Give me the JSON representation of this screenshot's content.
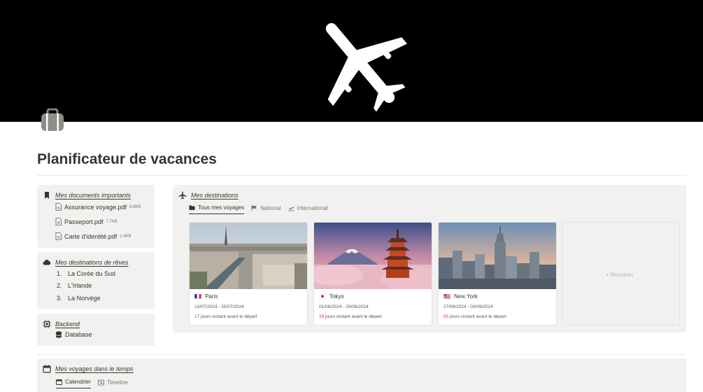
{
  "page": {
    "title": "Planificateur de vacances",
    "cover_icon": "airplane-icon",
    "page_icon": "luggage-icon"
  },
  "documents": {
    "title": "Mes documents importants",
    "icon": "bookmark-icon",
    "items": [
      {
        "name": "Assurance voyage.pdf",
        "size": "8.8KB",
        "icon": "file-icon"
      },
      {
        "name": "Passeport.pdf",
        "size": "7.7KB",
        "icon": "file-icon"
      },
      {
        "name": "Carte d'identité.pdf",
        "size": "1.4KB",
        "icon": "file-icon"
      }
    ]
  },
  "dreams": {
    "title": "Mes destinations de rêves",
    "icon": "cloud-icon",
    "items": [
      {
        "num": "1.",
        "label": "La Corée du Sud"
      },
      {
        "num": "2.",
        "label": "L'Irlande"
      },
      {
        "num": "3.",
        "label": "La Norvège"
      }
    ]
  },
  "backend": {
    "title": "Backend",
    "icon": "chip-icon",
    "items": [
      {
        "label": "Database",
        "icon": "database-icon"
      }
    ]
  },
  "destinations": {
    "title": "Mes destinations",
    "icon": "airplane-icon",
    "tabs": [
      {
        "label": "Tous mes voyages",
        "icon": "folder-icon",
        "active": true
      },
      {
        "label": "National",
        "icon": "flag-icon",
        "active": false
      },
      {
        "label": "International",
        "icon": "plane-takeoff-icon",
        "active": false
      }
    ],
    "cards": [
      {
        "flag": "🇫🇷",
        "name": "Paris",
        "dates": "10/07/2024 - 25/07/2024",
        "days": "17",
        "remaining_text": "jours restant avant le départ"
      },
      {
        "flag": "🇯🇵",
        "name": "Tokyo",
        "dates": "01/08/2024 - 20/08/2024",
        "days": "39",
        "remaining_text": "jours restant avant le départ"
      },
      {
        "flag": "🇺🇸",
        "name": "New York",
        "dates": "27/08/2024 - 03/09/2024",
        "days": "65",
        "remaining_text": "jours restant avant le départ"
      }
    ],
    "new_label": "+ Nouveau"
  },
  "timeline": {
    "title": "Mes voyages dans le temps",
    "icon": "calendar-icon",
    "tabs": [
      {
        "label": "Calendrier",
        "icon": "calendar-icon",
        "active": true
      },
      {
        "label": "Timeline",
        "icon": "timeline-icon",
        "active": false
      }
    ]
  }
}
